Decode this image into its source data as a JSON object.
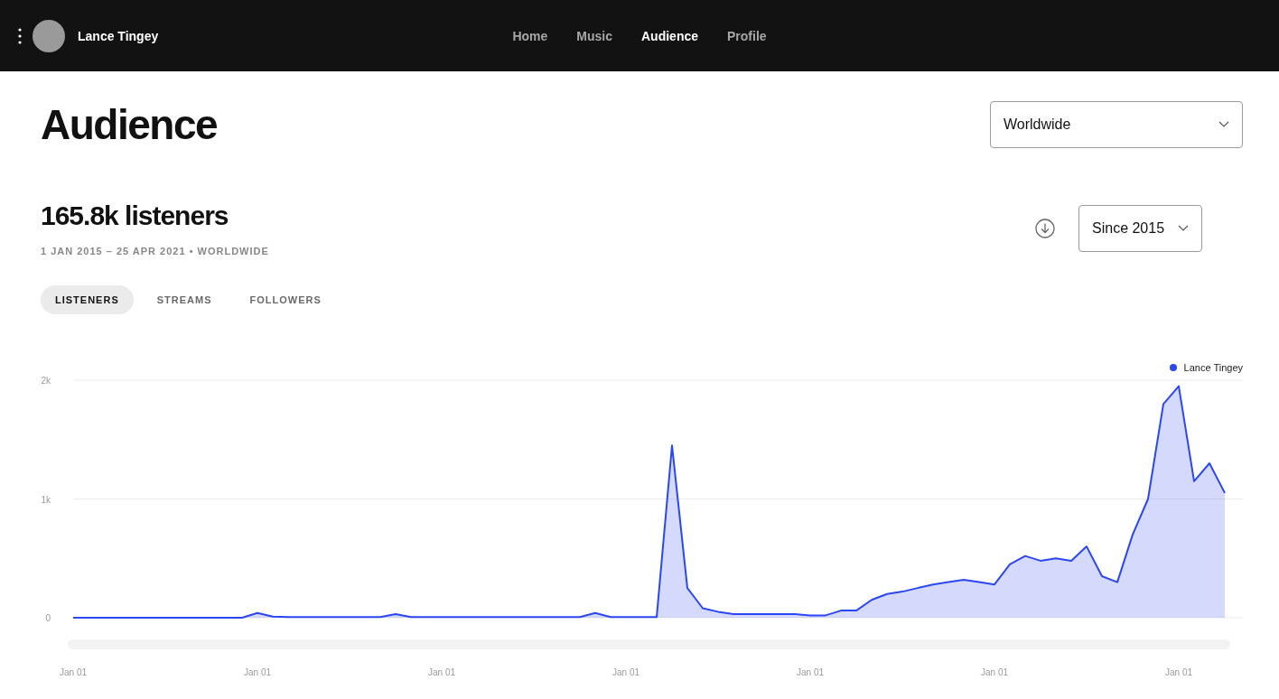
{
  "header": {
    "artist_name": "Lance Tingey",
    "nav": [
      {
        "label": "Home",
        "selected": false
      },
      {
        "label": "Music",
        "selected": false
      },
      {
        "label": "Audience",
        "selected": true
      },
      {
        "label": "Profile",
        "selected": false
      }
    ]
  },
  "page_title": "Audience",
  "region_dropdown": {
    "value": "Worldwide"
  },
  "stats": {
    "headline": "165.8k listeners",
    "subtitle": "1 JAN 2015 – 25 APR 2021 • WORLDWIDE",
    "period_dropdown": {
      "value": "Since 2015"
    }
  },
  "tabs": [
    {
      "label": "LISTENERS",
      "selected": true
    },
    {
      "label": "STREAMS",
      "selected": false
    },
    {
      "label": "FOLLOWERS",
      "selected": false
    }
  ],
  "chart": {
    "chart_data": {
      "type": "area",
      "categories": [
        "Jan 01",
        null,
        null,
        null,
        null,
        null,
        null,
        null,
        null,
        null,
        null,
        null,
        "Jan 01",
        null,
        null,
        null,
        null,
        null,
        null,
        null,
        null,
        null,
        null,
        null,
        "Jan 01",
        null,
        null,
        null,
        null,
        null,
        null,
        null,
        null,
        null,
        null,
        null,
        "Jan 01",
        null,
        null,
        null,
        null,
        null,
        null,
        null,
        null,
        null,
        null,
        null,
        "Jan 01",
        null,
        null,
        null,
        null,
        null,
        null,
        null,
        null,
        null,
        null,
        null,
        "Jan 01",
        null,
        null,
        null,
        null,
        null,
        null,
        null,
        null,
        null,
        null,
        null,
        "Jan 01",
        null,
        null,
        null
      ],
      "series": [
        {
          "name": "Lance Tingey",
          "color": "#2b47f5",
          "values": [
            0,
            0,
            0,
            0,
            0,
            0,
            0,
            0,
            0,
            0,
            0,
            0,
            40,
            10,
            5,
            5,
            5,
            5,
            5,
            5,
            5,
            30,
            5,
            5,
            5,
            5,
            5,
            5,
            5,
            5,
            5,
            5,
            5,
            5,
            40,
            5,
            5,
            5,
            5,
            1450,
            250,
            80,
            50,
            30,
            30,
            30,
            30,
            30,
            20,
            20,
            60,
            60,
            150,
            200,
            220,
            250,
            280,
            300,
            320,
            300,
            280,
            450,
            520,
            480,
            500,
            480,
            600,
            350,
            300,
            700,
            1000,
            1800,
            1950,
            1150,
            1300,
            1050
          ]
        }
      ],
      "ylim": [
        0,
        2000
      ],
      "yticks": [
        {
          "value": 0,
          "label": "0"
        },
        {
          "value": 1000,
          "label": "1k"
        },
        {
          "value": 2000,
          "label": "2k"
        }
      ]
    }
  }
}
